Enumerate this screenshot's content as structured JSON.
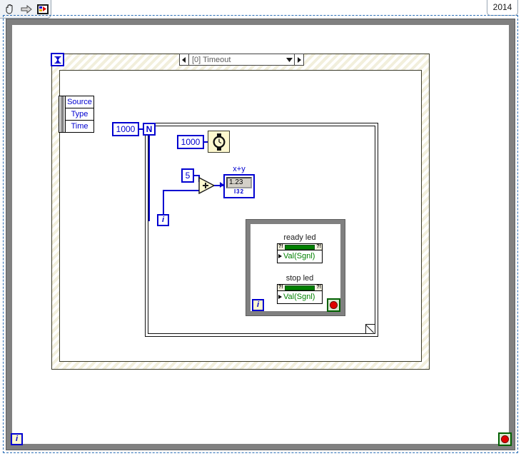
{
  "window": {
    "version_label": "2014"
  },
  "toolbar": {
    "items": [
      {
        "name": "hand-tool-icon",
        "label": "Hand Tool"
      },
      {
        "name": "arrow-icon",
        "label": "Run Arrow"
      },
      {
        "name": "vi-icon",
        "label": "VI Icon"
      }
    ]
  },
  "diagram": {
    "outer_loop": {
      "name": "While Loop",
      "iteration_label": "i",
      "stop_label": "stop"
    },
    "event_structure": {
      "case_label": "[0] Timeout",
      "left_arrow": "◀",
      "right_arrow": "▶",
      "caret": "▼",
      "hourglass": "⌛",
      "event_node": {
        "rows": [
          "Source",
          "Type",
          "Time"
        ]
      }
    },
    "for_loop": {
      "count_constant": "1000",
      "count_terminal": "N",
      "iteration_label": "i"
    },
    "wait_node": {
      "label": "Wait (ms)",
      "constant": "1000"
    },
    "add_node": {
      "symbol": "+",
      "constant": "5"
    },
    "indicator": {
      "label": "x+y",
      "value": "1.23",
      "representation": "I32"
    },
    "inner_loop": {
      "name": "While Loop",
      "iteration_label": "i",
      "stop_label": "stop",
      "property_nodes": [
        {
          "label": "ready led",
          "property": "Val(Sgnl)",
          "tag_left": "?!",
          "tag_right": "?!"
        },
        {
          "label": "stop led",
          "property": "Val(Sgnl)",
          "tag_left": "?!",
          "tag_right": "?!"
        }
      ]
    }
  },
  "colors": {
    "wire_blue": "#0000d0",
    "structure_grey": "#808080",
    "property_green": "#008000",
    "stop_red": "#e00000",
    "hatch_cream": "#f2efdc"
  }
}
